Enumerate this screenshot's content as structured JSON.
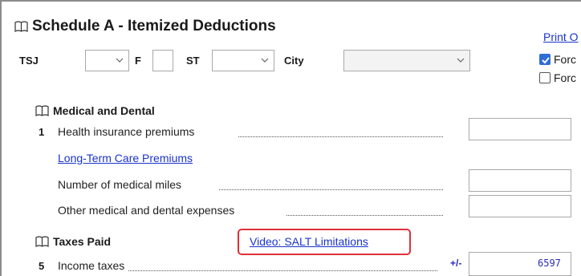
{
  "header": {
    "title": "Schedule A - Itemized Deductions",
    "print_options_label": "Print O"
  },
  "filters": {
    "tsj_label": "TSJ",
    "f_label": "F",
    "st_label": "ST",
    "city_label": "City"
  },
  "options": {
    "check1_label": "Forc",
    "check1_checked": true,
    "check2_label": "Forc",
    "check2_checked": false
  },
  "medical": {
    "section_title": "Medical and Dental",
    "line1_num": "1",
    "line1_label": "Health insurance premiums",
    "ltc_link": "Long-Term Care Premiums",
    "miles_label": "Number of medical miles",
    "other_label": "Other medical and dental expenses"
  },
  "taxes": {
    "section_title": "Taxes Paid",
    "video_link": "Video: SALT Limitations",
    "line5_num": "5",
    "line5_label": "Income taxes",
    "line5_adjust": "+/-",
    "line5_value": "6597"
  },
  "colors": {
    "link": "#1a33cc",
    "highlight": "#e0303a",
    "checkbox_accent": "#2f6ed6"
  }
}
